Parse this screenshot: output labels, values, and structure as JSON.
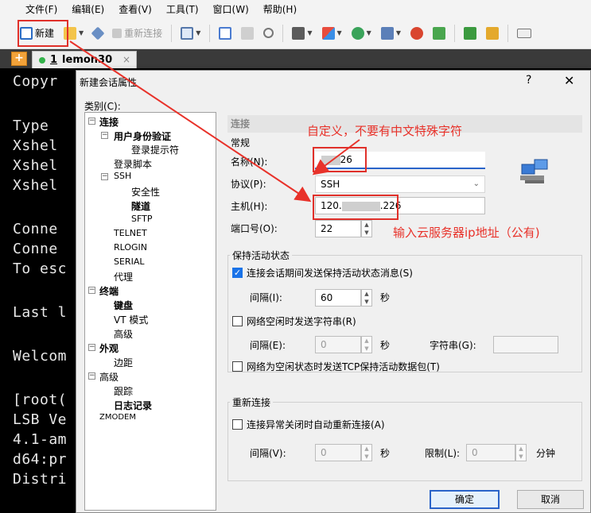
{
  "menu": [
    "文件(F)",
    "编辑(E)",
    "查看(V)",
    "工具(T)",
    "窗口(W)",
    "帮助(H)"
  ],
  "toolbar": {
    "new_label": "新建",
    "reconnect_label": "重新连接",
    "icons": [
      "new-session-icon",
      "open-folder-icon",
      "connect-icon",
      "reconnect-icon",
      "properties-icon",
      "copy-icon",
      "paste-icon",
      "find-icon",
      "print-icon",
      "transfer-icon",
      "globe-icon",
      "font-icon",
      "xftp-icon",
      "script-icon",
      "layout-icon",
      "lock-icon",
      "keyboard-icon"
    ],
    "colors": {
      "highlight": "#e0302a"
    }
  },
  "tabs": [
    {
      "number": "1",
      "label": "lemon30",
      "close": "×"
    }
  ],
  "terminal": {
    "lines": [
      "Copyr",
      "",
      "Type ",
      "Xshel",
      "Xshel",
      "Xshel",
      "",
      "Conne",
      "Conne",
      "To esc",
      "",
      "Last l",
      "",
      "Welcom",
      "",
      "[root(",
      "LSB Ve",
      "4.1-am",
      "d64:pr",
      "Distri"
    ]
  },
  "dialog": {
    "title": "新建会话属性",
    "help": "?",
    "close": "✕",
    "category_label": "类别(C):",
    "tree": [
      {
        "label": "连接",
        "bold": true
      },
      {
        "label": "用户身份验证",
        "bold": true
      },
      {
        "label": "登录提示符",
        "bold": false
      },
      {
        "label": "登录脚本",
        "bold": false
      },
      {
        "label": "SSH",
        "bold": false
      },
      {
        "label": "安全性",
        "bold": false
      },
      {
        "label": "隧道",
        "bold": true
      },
      {
        "label": "SFTP",
        "bold": false
      },
      {
        "label": "TELNET",
        "bold": false
      },
      {
        "label": "RLOGIN",
        "bold": false
      },
      {
        "label": "SERIAL",
        "bold": false
      },
      {
        "label": "代理",
        "bold": false
      },
      {
        "label": "终端",
        "bold": true
      },
      {
        "label": "键盘",
        "bold": true
      },
      {
        "label": "VT 模式",
        "bold": false
      },
      {
        "label": "高级",
        "bold": false
      },
      {
        "label": "外观",
        "bold": true
      },
      {
        "label": "边距",
        "bold": false
      },
      {
        "label": "高级",
        "bold": false
      },
      {
        "label": "跟踪",
        "bold": false
      },
      {
        "label": "日志记录",
        "bold": true
      },
      {
        "label": "ZMODEM",
        "bold": false
      }
    ],
    "section_title": "连接",
    "general_title": "常规",
    "name_label": "名称(N):",
    "name_value": "226",
    "protocol_label": "协议(P):",
    "protocol_value": "SSH",
    "host_label": "主机(H):",
    "host_prefix": "120.",
    "host_suffix": ".226",
    "port_label": "端口号(O):",
    "port_value": "22",
    "keepalive_title": "保持活动状态",
    "keepalive_check_label": "连接会话期间发送保持活动状态消息(S)",
    "keepalive_checked": true,
    "interval_label": "间隔(I):",
    "interval_value": "60",
    "seconds_unit": "秒",
    "idle_string_label": "网络空闲时发送字符串(R)",
    "idle_interval_label": "间隔(E):",
    "idle_interval_value": "0",
    "string_label": "字符串(G):",
    "tcp_keepalive_label": "网络为空闲状态时发送TCP保持活动数据包(T)",
    "reconnect_title": "重新连接",
    "auto_reconnect_label": "连接异常关闭时自动重新连接(A)",
    "reconnect_interval_label": "间隔(V):",
    "reconnect_interval_value": "0",
    "limit_label": "限制(L):",
    "limit_value": "0",
    "minutes_unit": "分钟",
    "ok_label": "确定",
    "cancel_label": "取消"
  },
  "annotations": {
    "name_note": "自定义，不要有中文特殊字符",
    "host_note": "输入云服务器ip地址（公有)",
    "color": "#e8322a"
  }
}
